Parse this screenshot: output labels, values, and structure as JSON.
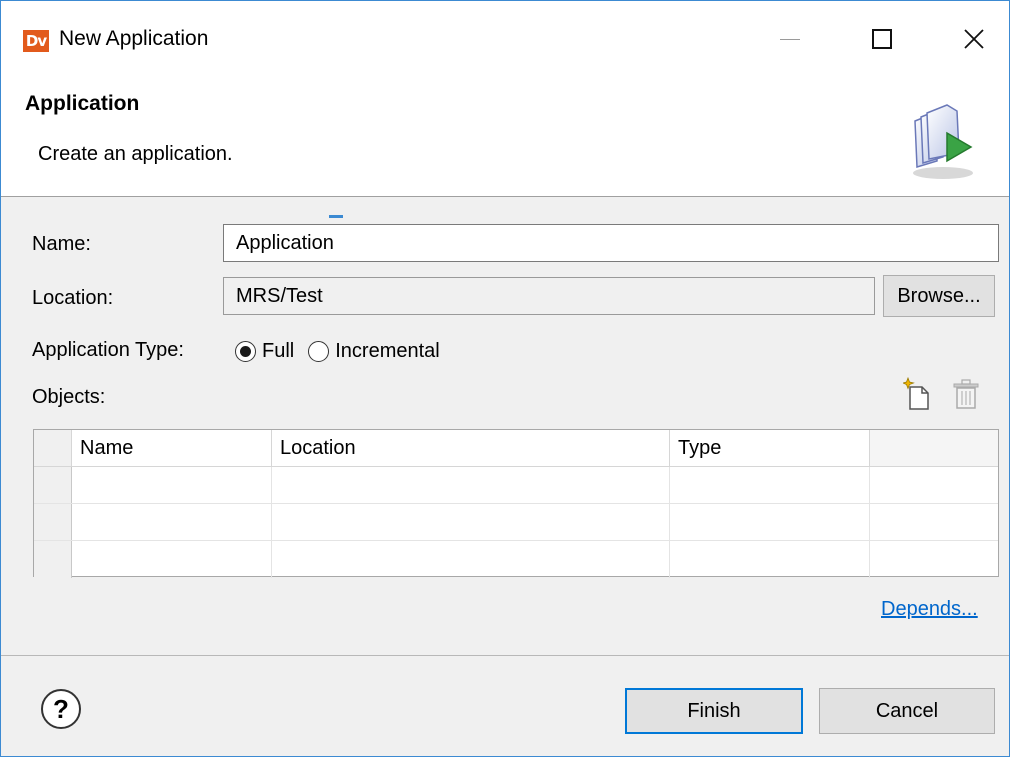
{
  "window": {
    "logo_text": "Dv",
    "title": "New Application",
    "close_glyph": "✕"
  },
  "header": {
    "title": "Application",
    "description": "Create an application.",
    "icon": "application-wizard-icon"
  },
  "form": {
    "name_label": "Name:",
    "name_value": "Application",
    "location_label": "Location:",
    "location_value": "MRS/Test",
    "browse_label": "Browse...",
    "type_label": "Application Type:",
    "type_options": [
      "Full",
      "Incremental"
    ],
    "type_selected": "Full",
    "objects_label": "Objects:"
  },
  "objects_table": {
    "columns": [
      "Name",
      "Location",
      "Type",
      ""
    ],
    "rows": [
      [
        "",
        "",
        "",
        ""
      ],
      [
        "",
        "",
        "",
        ""
      ],
      [
        "",
        "",
        "",
        ""
      ]
    ]
  },
  "depends_link": "Depends...",
  "footer": {
    "help_glyph": "?",
    "finish_label": "Finish",
    "cancel_label": "Cancel"
  },
  "icons": [
    "new-object-icon",
    "delete-icon",
    "help-icon"
  ],
  "colors": {
    "accent": "#0078d7",
    "link": "#0066cc",
    "logo": "#e25a1c"
  }
}
